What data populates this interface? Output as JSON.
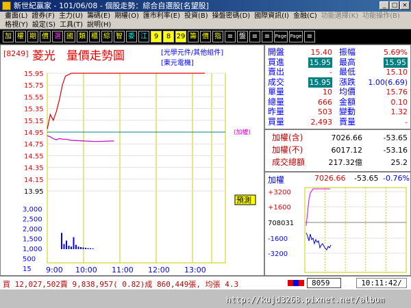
{
  "window": {
    "title": "新世紀贏家 - 101/06/08 - 個股走勢：綜合自選股[名望股]",
    "min": "_",
    "max": "□",
    "close": "×"
  },
  "menu": {
    "row1": [
      "畫面(L)",
      "證券(F)",
      "主力(U)",
      "籌碼(E)",
      "期權(O)",
      "匯市利率(E)",
      "投資(B)",
      "操盤密碼(D)",
      "國際資訊(I)",
      "金融(C)",
      "功能選擇(K)",
      "功能操作(B)"
    ],
    "row2": [
      "格視(Y)",
      "設定(S)",
      "工具(T)",
      "說明(H)"
    ]
  },
  "toolbar": {
    "buttons": [
      "加",
      "權",
      "期",
      "價",
      "選",
      "國",
      "類",
      "櫃",
      "綜",
      "智",
      "委",
      "江",
      "9",
      "8",
      "29",
      "籌",
      "價",
      "指",
      "≡",
      "盤",
      "≡",
      "≡",
      "Page",
      "Page",
      "≡"
    ]
  },
  "chart": {
    "code": "[8249]",
    "name": "菱光",
    "title": "量價走勢圖",
    "sector1": "[光學元件/其他組件]",
    "sector2": "[東元電機]",
    "price_ticks": [
      "15.95",
      "15.75",
      "15.55",
      "15.35",
      "15.15",
      "14.95",
      "14.75",
      "14.55",
      "14.35",
      "14.15",
      "13.95"
    ],
    "vol_ticks": [
      "3,000",
      "2,500",
      "2,000",
      "1,500",
      "1,000",
      "500",
      "15",
      "張"
    ],
    "time_ticks": [
      "9:00",
      "10:00",
      "11:00",
      "12:00",
      "13:00"
    ],
    "index_label": "(加權)",
    "badge": "預測"
  },
  "chart_data": {
    "type": "line",
    "x": [
      "9:00",
      "9:05",
      "9:10",
      "9:15",
      "9:20",
      "9:25",
      "9:30",
      "9:40",
      "10:00",
      "10:20",
      "10:50"
    ],
    "series": [
      {
        "values": [
          15.0,
          15.25,
          15.15,
          15.3,
          15.5,
          15.75,
          15.9,
          15.95,
          15.95,
          15.95,
          15.95
        ]
      },
      {
        "values": [
          14.89,
          14.87,
          14.84,
          14.82,
          14.84,
          14.83,
          14.83,
          14.81,
          14.8,
          14.79,
          14.8
        ]
      }
    ],
    "volume": [
      950,
      300,
      500,
      200,
      150,
      700,
      250,
      150,
      120,
      100,
      80,
      60,
      50,
      40
    ],
    "ylim": [
      13.95,
      15.95
    ],
    "vol_lim": [
      0,
      3000
    ]
  },
  "quote": {
    "rows": [
      {
        "l1": "開盤",
        "v1": "15.40",
        "l2": "振幅",
        "v2": "5.69%"
      },
      {
        "l1": "買進",
        "v1": "15.95",
        "l2": "最高",
        "v2": "15.95"
      },
      {
        "l1": "賣出",
        "v1": "-",
        "l2": "最低",
        "v2": "15.10"
      },
      {
        "l1": "成交",
        "v1": "15.95",
        "l2": "漲跌",
        "v2": "1.00(6.69)"
      },
      {
        "l1": "單量",
        "v1": "10",
        "l2": "均價",
        "v2": "15.76"
      },
      {
        "l1": "總量",
        "v1": "666",
        "l2": "金額",
        "v2": "0.10"
      },
      {
        "l1": "昨量",
        "v1": "503",
        "l2": "變動",
        "v2": "1.32"
      },
      {
        "l1": "買量",
        "v1": "2,493",
        "l2": "賣量",
        "v2": "-"
      }
    ],
    "idx": [
      {
        "l": "加權(含)",
        "v": "7026.66",
        "c": "-53.65"
      },
      {
        "l": "加權(不)",
        "v": "6017.12",
        "c": "-53.16"
      },
      {
        "l": "成交總額",
        "v": "217.32億",
        "c": "25.2"
      }
    ]
  },
  "mini": {
    "label": "加權",
    "value": "7026.66",
    "change": "-53.65",
    "pct": "-0.76%",
    "ticks": [
      "+3200",
      "+1600",
      "708031",
      "-1600",
      "-3200"
    ]
  },
  "status": {
    "text": "買 12,027,502賣 9,838,957( 0.82)成 860,449張, 均張 4.3",
    "code": "8059",
    "time": "10:11:42/"
  },
  "footer": {
    "url": "http://kujd3268.pixnet.net/album"
  }
}
